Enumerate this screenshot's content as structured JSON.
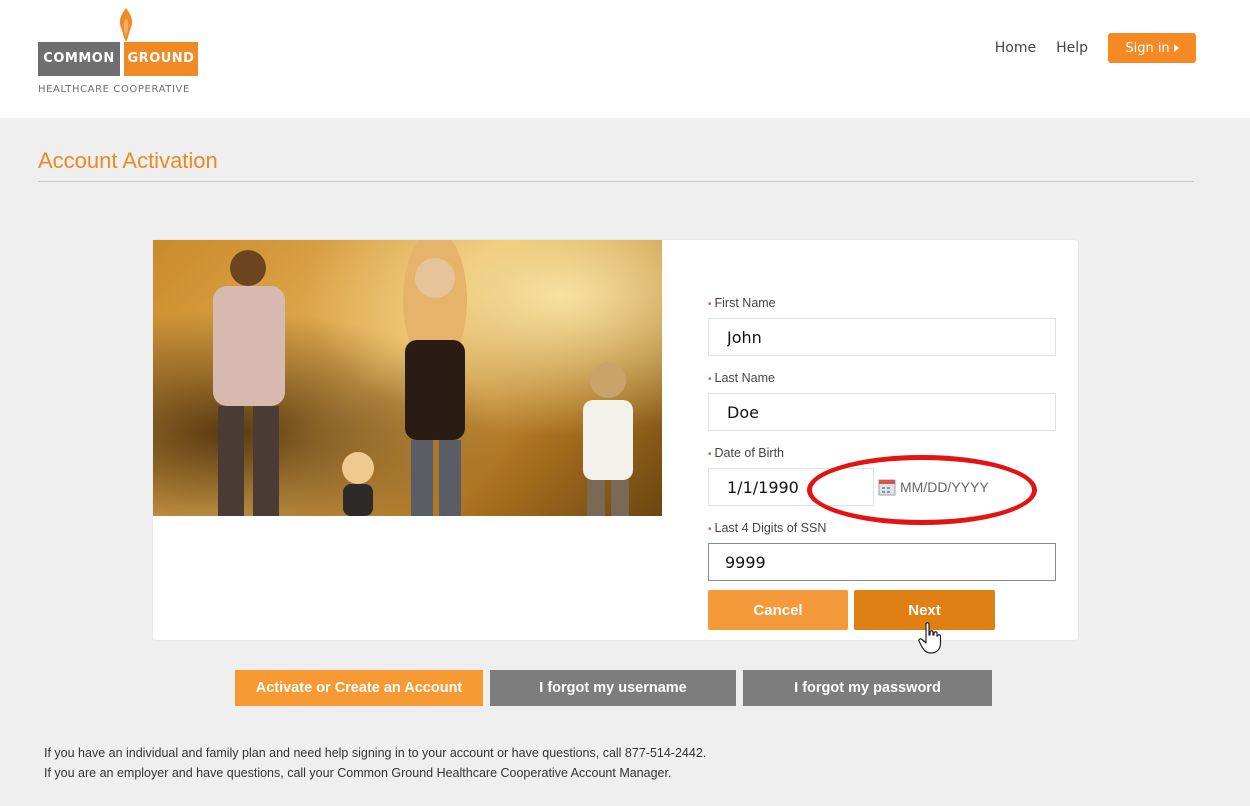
{
  "header": {
    "logo": {
      "word1": "COMMON",
      "word2": "GROUND",
      "tagline": "HEALTHCARE COOPERATIVE"
    },
    "nav": {
      "home": "Home",
      "help": "Help",
      "signin": "Sign in"
    }
  },
  "page": {
    "title": "Account Activation"
  },
  "form": {
    "first_name": {
      "label": "First Name",
      "value": "John"
    },
    "last_name": {
      "label": "Last Name",
      "value": "Doe"
    },
    "dob": {
      "label": "Date of Birth",
      "value": "1/1/1990",
      "hint": "MM/DD/YYYY"
    },
    "ssn": {
      "label": "Last 4 Digits of SSN",
      "value": "9999"
    },
    "required_marker": "•",
    "cancel_label": "Cancel",
    "next_label": "Next"
  },
  "links": {
    "activate": "Activate or Create an Account",
    "forgot_username": "I forgot my username",
    "forgot_password": "I forgot my password"
  },
  "footer": {
    "line1": "If you have an individual and family plan and need help signing in to your account or have questions, call 877-514-2442.",
    "line2": "If you are an employer and have questions, call your Common Ground Healthcare Cooperative Account Manager."
  },
  "colors": {
    "accent": "#f58a25",
    "highlight": "#e41212",
    "grey_button": "#7d7d7d"
  }
}
